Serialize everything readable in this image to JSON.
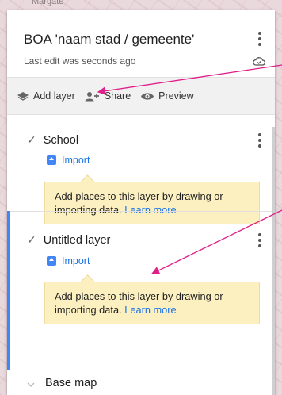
{
  "map": {
    "label": "Margate"
  },
  "header": {
    "title": "BOA 'naam stad / gemeente'",
    "subtitle": "Last edit was seconds ago"
  },
  "toolbar": {
    "add_layer_label": "Add layer",
    "share_label": "Share",
    "preview_label": "Preview"
  },
  "layers": [
    {
      "name": "School",
      "checked": true,
      "import_label": "Import",
      "tip_text": "Add places to this layer by drawing or importing data.",
      "tip_link": "Learn more"
    },
    {
      "name": "Untitled layer",
      "checked": true,
      "import_label": "Import",
      "tip_text": "Add places to this layer by drawing or importing data.",
      "tip_link": "Learn more"
    }
  ],
  "base_map": {
    "label": "Base map"
  },
  "colors": {
    "accent": "#4285f4",
    "annotation_arrow": "#e0208a",
    "tip_bg": "#fcf0c0",
    "link": "#1a73e8"
  }
}
